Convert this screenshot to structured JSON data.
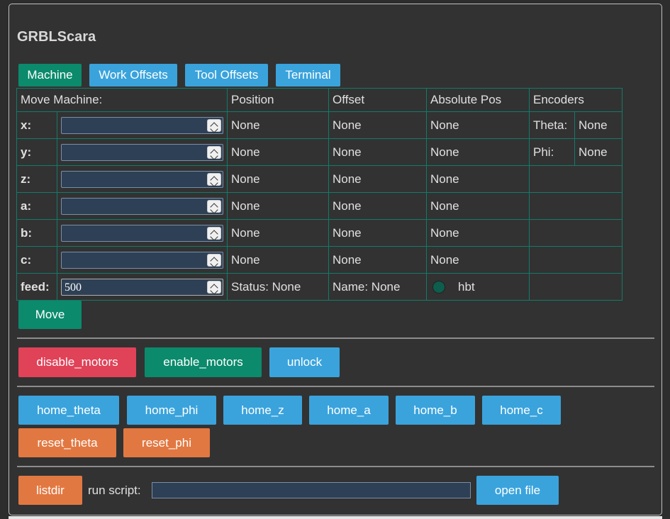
{
  "title": "GRBLScara",
  "tabs": [
    {
      "label": "Machine",
      "active": true
    },
    {
      "label": "Work Offsets",
      "active": false
    },
    {
      "label": "Tool Offsets",
      "active": false
    },
    {
      "label": "Terminal",
      "active": false
    }
  ],
  "table": {
    "headers": {
      "move": "Move Machine:",
      "position": "Position",
      "offset": "Offset",
      "absolute": "Absolute Pos",
      "encoders": "Encoders"
    },
    "rows": [
      {
        "axis": "x:",
        "value": "",
        "position": "None",
        "offset": "None",
        "absolute": "None",
        "enc_label": "Theta:",
        "enc_value": "None"
      },
      {
        "axis": "y:",
        "value": "",
        "position": "None",
        "offset": "None",
        "absolute": "None",
        "enc_label": "Phi:",
        "enc_value": "None"
      },
      {
        "axis": "z:",
        "value": "",
        "position": "None",
        "offset": "None",
        "absolute": "None"
      },
      {
        "axis": "a:",
        "value": "",
        "position": "None",
        "offset": "None",
        "absolute": "None"
      },
      {
        "axis": "b:",
        "value": "",
        "position": "None",
        "offset": "None",
        "absolute": "None"
      },
      {
        "axis": "c:",
        "value": "",
        "position": "None",
        "offset": "None",
        "absolute": "None"
      }
    ],
    "feed": {
      "label": "feed:",
      "value": "500",
      "status": "Status: None",
      "name": "Name: None",
      "hbt": "hbt"
    }
  },
  "move_label": "Move",
  "motor_buttons": {
    "disable": "disable_motors",
    "enable": "enable_motors",
    "unlock": "unlock"
  },
  "home_buttons": [
    "home_theta",
    "home_phi",
    "home_z",
    "home_a",
    "home_b",
    "home_c"
  ],
  "reset_buttons": [
    "reset_theta",
    "reset_phi"
  ],
  "script": {
    "listdir": "listdir",
    "run_label": "run script:",
    "value": "",
    "open_file": "open file"
  },
  "colors": {
    "blue": "#3aa3dc",
    "green": "#0b8a6c",
    "red": "#e04258",
    "orange": "#e27841",
    "grid": "#137a6a"
  }
}
